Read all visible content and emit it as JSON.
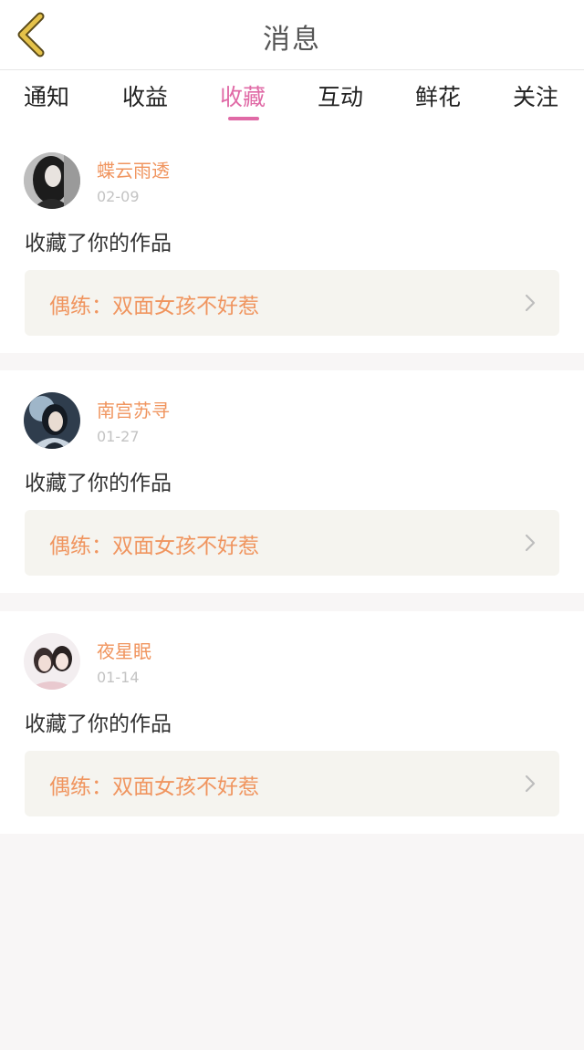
{
  "header": {
    "title": "消息",
    "back_icon": "chevron-left-icon"
  },
  "tabs": [
    {
      "label": "通知",
      "active": false
    },
    {
      "label": "收益",
      "active": false
    },
    {
      "label": "收藏",
      "active": true
    },
    {
      "label": "互动",
      "active": false
    },
    {
      "label": "鲜花",
      "active": false
    },
    {
      "label": "关注",
      "active": false
    }
  ],
  "colors": {
    "accent_pink": "#e06aa6",
    "name_orange": "#f0955f",
    "back_icon_yellow": "#e5c24a"
  },
  "notifications": [
    {
      "username": "蝶云雨透",
      "date": "02-09",
      "action": "收藏了你的作品",
      "work_title": "偶练：双面女孩不好惹"
    },
    {
      "username": "南宫苏寻",
      "date": "01-27",
      "action": "收藏了你的作品",
      "work_title": "偶练：双面女孩不好惹"
    },
    {
      "username": "夜星眠",
      "date": "01-14",
      "action": "收藏了你的作品",
      "work_title": "偶练：双面女孩不好惹"
    }
  ]
}
